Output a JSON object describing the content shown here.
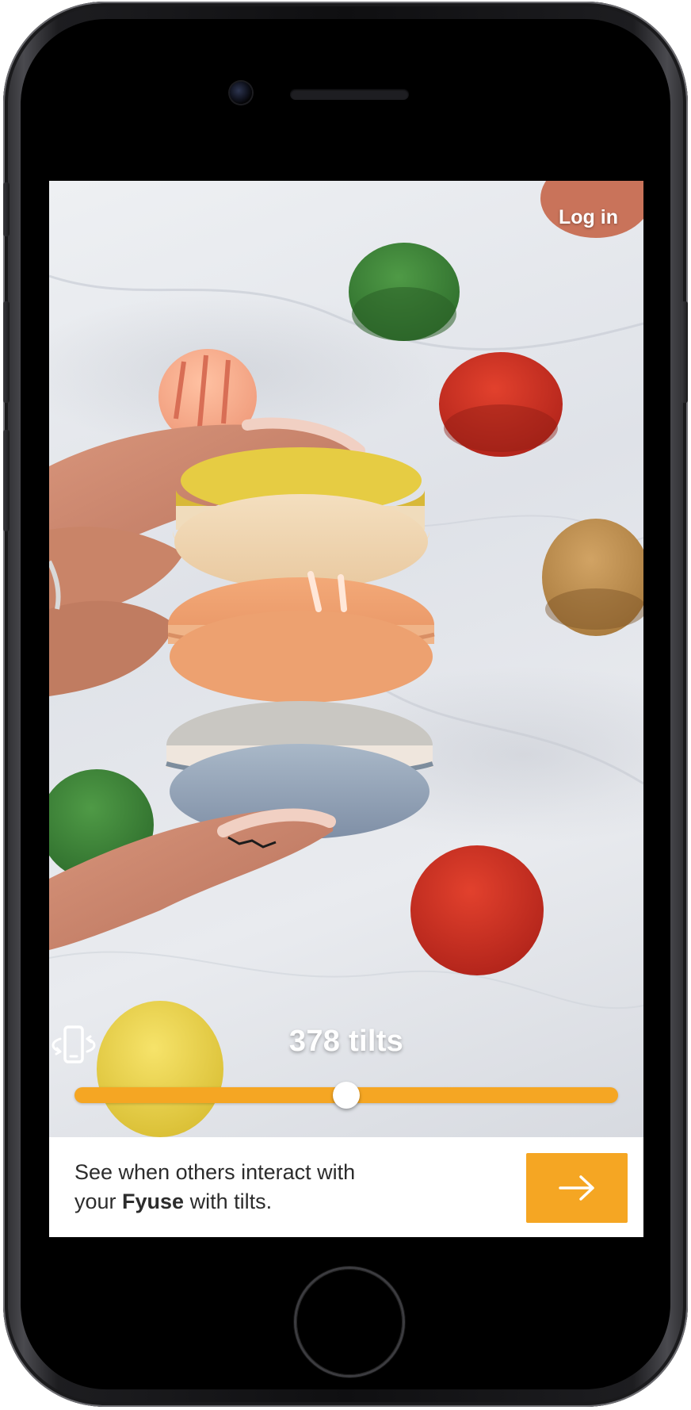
{
  "header": {
    "login_label": "Log in"
  },
  "viewer": {
    "tilts_count_label": "378 tilts",
    "tilt_icon": "phone-tilt-icon",
    "slider_value_fraction": 0.5
  },
  "promo": {
    "line1": "See when others interact with",
    "line2_prefix": "your ",
    "brand": "Fyuse",
    "line2_suffix": " with tilts."
  },
  "next_button": {
    "icon": "arrow-right-icon"
  },
  "colors": {
    "accent": "#f5a623",
    "text": "#2c2c2c",
    "white": "#ffffff"
  }
}
